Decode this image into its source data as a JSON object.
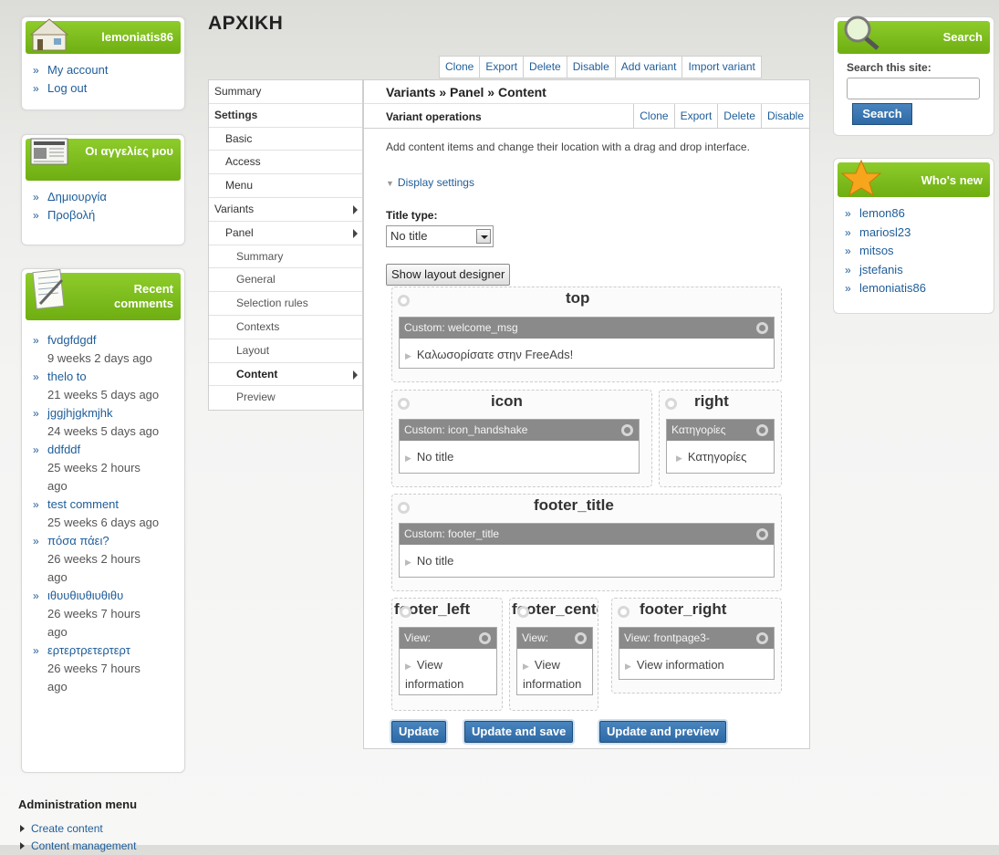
{
  "user_block": {
    "title": "lemoniatis86",
    "links": [
      "My account",
      "Log out"
    ]
  },
  "ads_block": {
    "title": "Οι αγγελίες μου",
    "links": [
      "Δημιουργία",
      "Προβολή"
    ]
  },
  "comments_block": {
    "title": "Recent comments",
    "items": [
      {
        "title": "fvdgfdgdf",
        "meta": "9 weeks 2 days ago"
      },
      {
        "title": "thelo to",
        "meta": "21 weeks 5 days ago"
      },
      {
        "title": "jggjhjgkmjhk",
        "meta": "24 weeks 5 days ago"
      },
      {
        "title": "ddfddf",
        "meta": "25 weeks 2 hours ago"
      },
      {
        "title": "test comment",
        "meta": "25 weeks 6 days ago"
      },
      {
        "title": "πόσα πάει?",
        "meta": "26 weeks 2 hours ago"
      },
      {
        "title": "ιθυυθιυθιυθιθυ",
        "meta": "26 weeks 7 hours ago"
      },
      {
        "title": "ερτερτρετερτερτ",
        "meta": "26 weeks 7 hours ago"
      }
    ]
  },
  "page": {
    "title": "ΑΡΧΙΚΗ"
  },
  "top_tabs": [
    "Clone",
    "Export",
    "Delete",
    "Disable",
    "Add variant",
    "Import variant"
  ],
  "vnav": [
    {
      "label": "Summary",
      "level": 0,
      "bold": false,
      "arrow": false
    },
    {
      "label": "Settings",
      "level": 0,
      "bold": true,
      "arrow": false
    },
    {
      "label": "Basic",
      "level": 1,
      "bold": false,
      "arrow": false
    },
    {
      "label": "Access",
      "level": 1,
      "bold": false,
      "arrow": false
    },
    {
      "label": "Menu",
      "level": 1,
      "bold": false,
      "arrow": false
    },
    {
      "label": "Variants",
      "level": 0,
      "bold": false,
      "arrow": true
    },
    {
      "label": "Panel",
      "level": 1,
      "bold": false,
      "arrow": true
    },
    {
      "label": "Summary",
      "level": 2,
      "bold": false,
      "arrow": false
    },
    {
      "label": "General",
      "level": 2,
      "bold": false,
      "arrow": false
    },
    {
      "label": "Selection rules",
      "level": 2,
      "bold": false,
      "arrow": false
    },
    {
      "label": "Contexts",
      "level": 2,
      "bold": false,
      "arrow": false
    },
    {
      "label": "Layout",
      "level": 2,
      "bold": false,
      "arrow": false
    },
    {
      "label": "Content",
      "level": 2,
      "bold": true,
      "arrow": true
    },
    {
      "label": "Preview",
      "level": 2,
      "bold": false,
      "arrow": false
    }
  ],
  "content": {
    "breadcrumb": "Variants » Panel » Content",
    "ops_label": "Variant operations",
    "ops": [
      "Clone",
      "Export",
      "Delete",
      "Disable"
    ],
    "description": "Add content items and change their location with a drag and drop interface.",
    "display_settings": "Display settings",
    "title_type_label": "Title type:",
    "title_type_value": "No title",
    "layout_button": "Show layout designer"
  },
  "regions": {
    "top": {
      "title": "top",
      "pane_head": "Custom: welcome_msg",
      "pane_body": "Καλωσορίσατε στην FreeAds!"
    },
    "icon": {
      "title": "icon",
      "pane_head": "Custom: icon_handshake",
      "pane_body": "No title"
    },
    "right": {
      "title": "right",
      "pane_head": "Κατηγορίες",
      "pane_body": "Κατηγορίες"
    },
    "footer_title": {
      "title": "footer_title",
      "pane_head": "Custom: footer_title",
      "pane_body": "No title"
    },
    "footer_left": {
      "title": "footer_left",
      "pane_head": "View:",
      "pane_body": "View information"
    },
    "footer_center": {
      "title": "footer_cente",
      "pane_head": "View:",
      "pane_body": "View information"
    },
    "footer_right": {
      "title": "footer_right",
      "pane_head": "View: frontpage3-",
      "pane_body": "View information"
    }
  },
  "buttons": {
    "update": "Update",
    "update_save": "Update and save",
    "update_preview": "Update and preview"
  },
  "search_block": {
    "title": "Search",
    "label": "Search this site:",
    "button": "Search"
  },
  "whos_new": {
    "title": "Who's new",
    "users": [
      "lemon86",
      "mariosl23",
      "mitsos",
      "jstefanis",
      "lemoniatis86"
    ]
  },
  "admin_menu": {
    "title": "Administration menu",
    "items": [
      "Create content",
      "Content management"
    ]
  },
  "colors": {
    "block_header": "#7cbd1c",
    "link": "#1f5d99",
    "pane_header": "#8a8a8a",
    "button": "#2d6aa6"
  },
  "icons": [
    "home-icon",
    "newspaper-icon",
    "notepad-icon",
    "magnifier-icon",
    "star-icon",
    "gear-icon",
    "triangle-right-icon",
    "triangle-down-icon"
  ]
}
